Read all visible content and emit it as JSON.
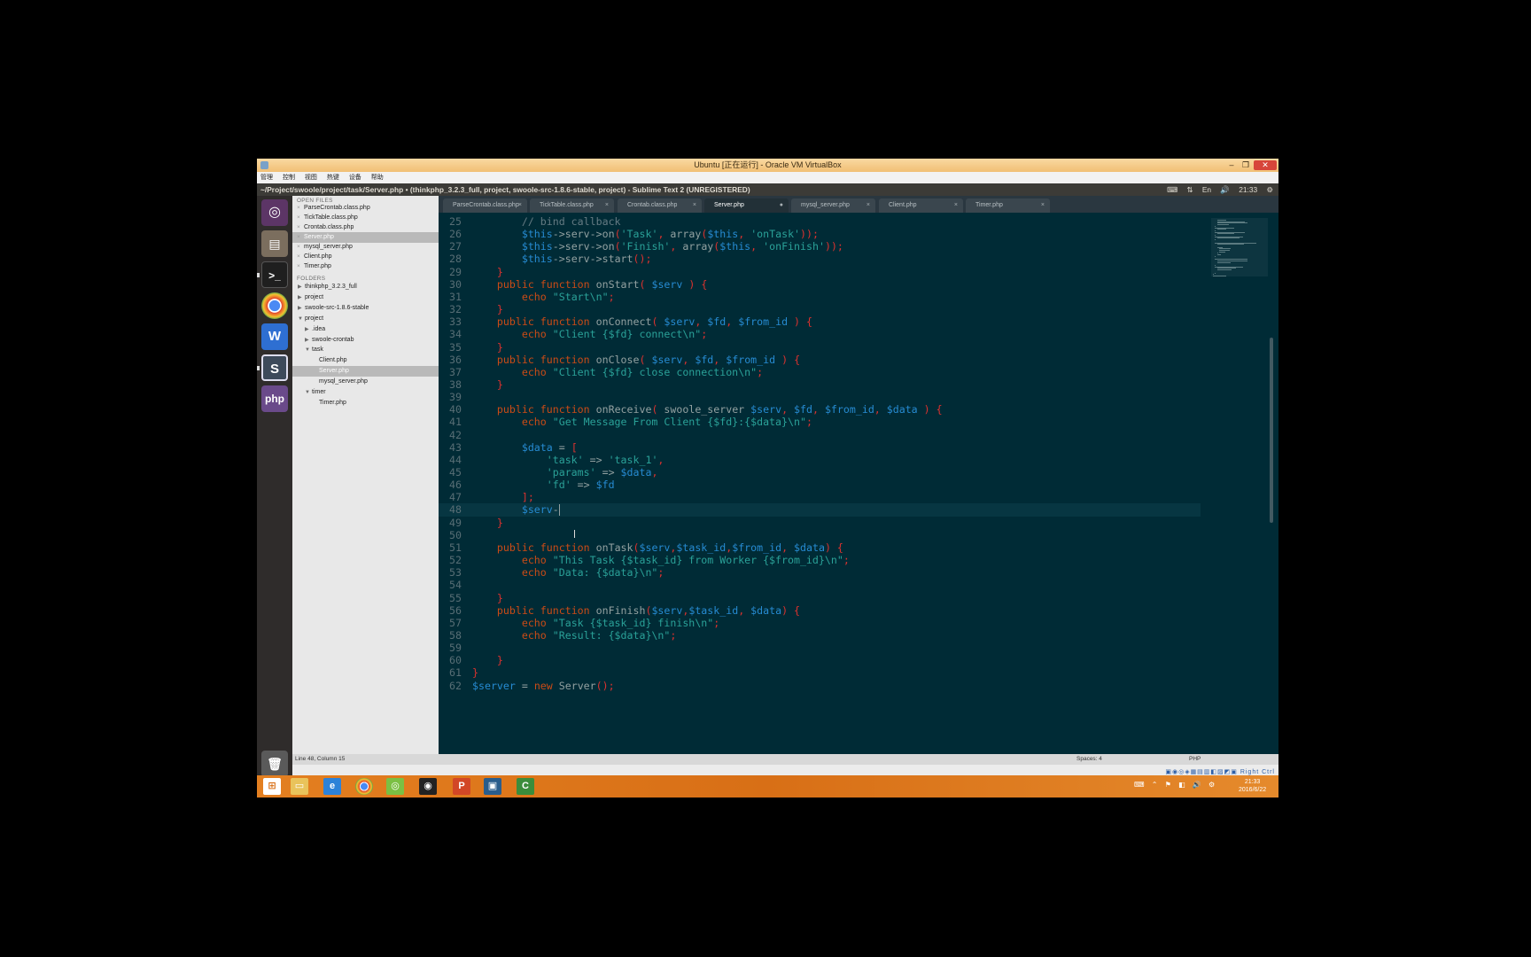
{
  "vbox": {
    "title": "Ubuntu [正在运行] - Oracle VM VirtualBox",
    "minimize": "–",
    "maximize": "❐",
    "close": "✕",
    "menu": [
      "管理",
      "控制",
      "视图",
      "热键",
      "设备",
      "帮助"
    ]
  },
  "ubuntu": {
    "window_title": "~/Project/swoole/project/task/Server.php • (thinkphp_3.2.3_full, project, swoole-src-1.8.6-stable, project) - Sublime Text 2 (UNREGISTERED)",
    "indicators": [
      "⌨",
      "⇅",
      "En",
      "🔊",
      "21:33",
      "⚙"
    ]
  },
  "launcher": {
    "dash": "◎",
    "files": "▤",
    "terminal": ">_",
    "chrome": "",
    "word": "W",
    "sublime": "S",
    "php": "php",
    "trash": "🗑"
  },
  "sidebar": {
    "open_files_header": "OPEN FILES",
    "open_files": [
      {
        "name": "ParseCrontab.class.php",
        "active": false
      },
      {
        "name": "TickTable.class.php",
        "active": false
      },
      {
        "name": "Crontab.class.php",
        "active": false
      },
      {
        "name": "Server.php",
        "active": true
      },
      {
        "name": "mysql_server.php",
        "active": false
      },
      {
        "name": "Client.php",
        "active": false
      },
      {
        "name": "Timer.php",
        "active": false
      }
    ],
    "folders_header": "FOLDERS",
    "folders": [
      {
        "name": "thinkphp_3.2.3_full",
        "tri": "▶"
      },
      {
        "name": "project",
        "tri": "▶"
      },
      {
        "name": "swoole-src-1.8.6-stable",
        "tri": "▶"
      },
      {
        "name": "project",
        "tri": "▼"
      },
      {
        "name": ".idea",
        "tri": "▶"
      },
      {
        "name": "swoole-crontab",
        "tri": "▶"
      },
      {
        "name": "task",
        "tri": "▼"
      },
      {
        "name": "Client.php",
        "tri": ""
      },
      {
        "name": "Server.php",
        "tri": ""
      },
      {
        "name": "mysql_server.php",
        "tri": ""
      },
      {
        "name": "timer",
        "tri": "▼"
      },
      {
        "name": "Timer.php",
        "tri": ""
      }
    ]
  },
  "tabs": [
    {
      "label": "ParseCrontab.class.php",
      "close": "×"
    },
    {
      "label": "TickTable.class.php",
      "close": "×"
    },
    {
      "label": "Crontab.class.php",
      "close": "×"
    },
    {
      "label": "Server.php",
      "close": "●"
    },
    {
      "label": "mysql_server.php",
      "close": "×"
    },
    {
      "label": "Client.php",
      "close": "×"
    },
    {
      "label": "Timer.php",
      "close": "×"
    }
  ],
  "editor": {
    "lines": [
      {
        "n": "25",
        "t": "        // bind callback"
      },
      {
        "n": "26",
        "t": "        $this->serv->on('Task', array($this, 'onTask'));"
      },
      {
        "n": "27",
        "t": "        $this->serv->on('Finish', array($this, 'onFinish'));"
      },
      {
        "n": "28",
        "t": "        $this->serv->start();"
      },
      {
        "n": "29",
        "t": "    }"
      },
      {
        "n": "30",
        "t": "    public function onStart( $serv ) {"
      },
      {
        "n": "31",
        "t": "        echo \"Start\\n\";"
      },
      {
        "n": "32",
        "t": "    }"
      },
      {
        "n": "33",
        "t": "    public function onConnect( $serv, $fd, $from_id ) {"
      },
      {
        "n": "34",
        "t": "        echo \"Client {$fd} connect\\n\";"
      },
      {
        "n": "35",
        "t": "    }"
      },
      {
        "n": "36",
        "t": "    public function onClose( $serv, $fd, $from_id ) {"
      },
      {
        "n": "37",
        "t": "        echo \"Client {$fd} close connection\\n\";"
      },
      {
        "n": "38",
        "t": "    }"
      },
      {
        "n": "39",
        "t": ""
      },
      {
        "n": "40",
        "t": "    public function onReceive( swoole_server $serv, $fd, $from_id, $data ) {"
      },
      {
        "n": "41",
        "t": "        echo \"Get Message From Client {$fd}:{$data}\\n\";"
      },
      {
        "n": "42",
        "t": ""
      },
      {
        "n": "43",
        "t": "        $data = ["
      },
      {
        "n": "44",
        "t": "            'task' => 'task_1',"
      },
      {
        "n": "45",
        "t": "            'params' => $data,"
      },
      {
        "n": "46",
        "t": "            'fd' => $fd"
      },
      {
        "n": "47",
        "t": "        ];"
      },
      {
        "n": "48",
        "t": "        $serv-"
      },
      {
        "n": "49",
        "t": "    }"
      },
      {
        "n": "50",
        "t": ""
      },
      {
        "n": "51",
        "t": "    public function onTask($serv,$task_id,$from_id, $data) {"
      },
      {
        "n": "52",
        "t": "        echo \"This Task {$task_id} from Worker {$from_id}\\n\";"
      },
      {
        "n": "53",
        "t": "        echo \"Data: {$data}\\n\";"
      },
      {
        "n": "54",
        "t": ""
      },
      {
        "n": "55",
        "t": "    }"
      },
      {
        "n": "56",
        "t": "    public function onFinish($serv,$task_id, $data) {"
      },
      {
        "n": "57",
        "t": "        echo \"Task {$task_id} finish\\n\";"
      },
      {
        "n": "58",
        "t": "        echo \"Result: {$data}\\n\";"
      },
      {
        "n": "59",
        "t": ""
      },
      {
        "n": "60",
        "t": "    }"
      },
      {
        "n": "61",
        "t": "}"
      },
      {
        "n": "62",
        "t": "$server = new Server();"
      }
    ],
    "current_line": "48"
  },
  "statusbar": {
    "position": "Line 48, Column 15",
    "spaces": "Spaces: 4",
    "syntax": "PHP"
  },
  "vb_status_icons": "▣◉◎◈▦▤▥◧▨◩▣ Right Ctrl",
  "taskbar": {
    "start": "⊞",
    "explorer": "▭",
    "ie": "e",
    "chrome": "",
    "wechat": "◎",
    "qq": "◉",
    "ppt": "P",
    "vbox": "▣",
    "camtasia": "C",
    "tray": "⌨ ⌃ ⚑ ◧ 🔊 ⚙",
    "time": "21:33",
    "date": "2016/6/22"
  }
}
